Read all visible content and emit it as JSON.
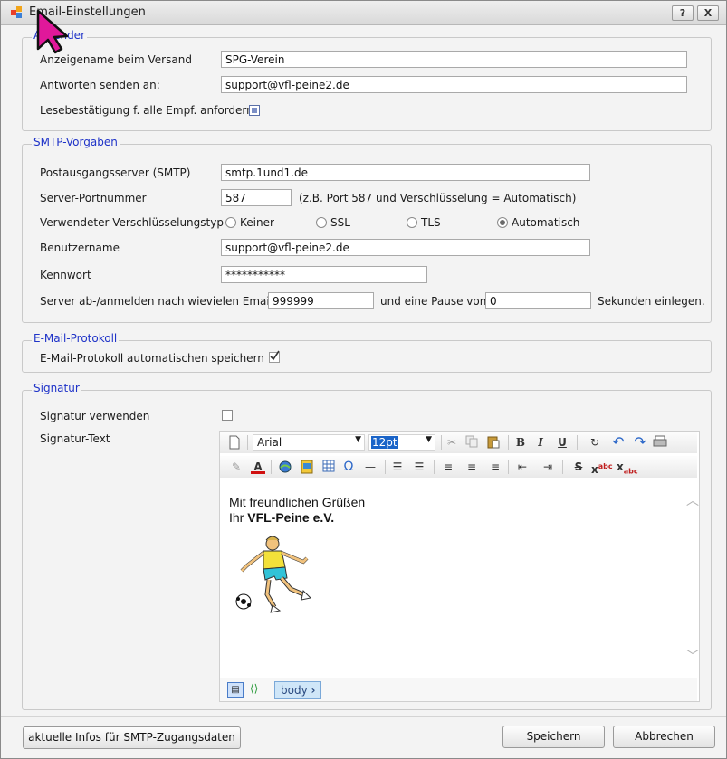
{
  "window": {
    "title": "Email-Einstellungen",
    "help_label": "?",
    "close_label": "X"
  },
  "absender": {
    "legend": "Absender",
    "display_name_label": "Anzeigename beim Versand",
    "display_name_value": "SPG-Verein",
    "reply_to_label": "Antworten senden an:",
    "reply_to_value": "support@vfl-peine2.de",
    "read_receipt_label": "Lesebestätigung f. alle Empf. anfordern"
  },
  "smtp": {
    "legend": "SMTP-Vorgaben",
    "server_label": "Postausgangsserver (SMTP)",
    "server_value": "smtp.1und1.de",
    "port_label": "Server-Portnummer",
    "port_value": "587",
    "port_hint": "(z.B. Port 587 und Verschlüsselung = Automatisch)",
    "encryption_label": "Verwendeter Verschlüsselungstyp",
    "encryption_options": [
      "Keiner",
      "SSL",
      "TLS",
      "Automatisch"
    ],
    "encryption_selected": "Automatisch",
    "username_label": "Benutzername",
    "username_value": "support@vfl-peine2.de",
    "password_label": "Kennwort",
    "password_value": "***********",
    "relogin_label": "Server ab-/anmelden nach wievielen Emails?",
    "relogin_value": "999999",
    "pause_label": "und eine Pause von",
    "pause_value": "0",
    "seconds_label": "Sekunden einlegen."
  },
  "protokoll": {
    "legend": "E-Mail-Protokoll",
    "autosave_label": "E-Mail-Protokoll automatischen speichern",
    "autosave_checked": true
  },
  "signatur": {
    "legend": "Signatur",
    "use_label": "Signatur verwenden",
    "use_checked": false,
    "text_label": "Signatur-Text",
    "font_name": "Arial",
    "font_size": "12pt",
    "line1": "Mit freundlichen Grüßen",
    "line2_prefix": "Ihr ",
    "line2_bold": "VFL-Peine e.V.",
    "tag_label": "body",
    "image": "soccer-player-clipart"
  },
  "footer": {
    "smtp_info_button": "aktuelle Infos für SMTP-Zugangsdaten",
    "save_button": "Speichern",
    "cancel_button": "Abbrechen"
  },
  "colors": {
    "legend": "#1f33c8",
    "accent_pointer": "#e0189a"
  }
}
